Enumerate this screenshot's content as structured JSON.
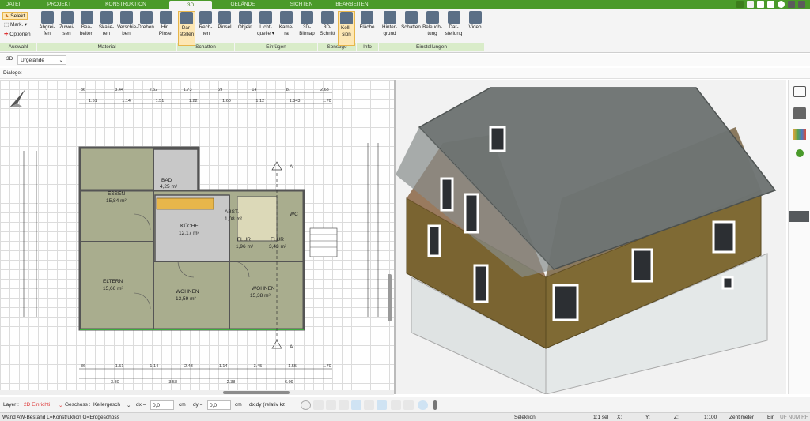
{
  "menu": {
    "tabs": [
      "DATEI",
      "PROJEKT",
      "KONSTRUKTION",
      "3D",
      "GELÄNDE",
      "SICHTEN",
      "BEARBEITEN"
    ],
    "active": "3D"
  },
  "ribbon": {
    "auswahl": {
      "selekt": "Selekt",
      "mark": "Mark.",
      "optionen": "Optionen",
      "group": "Auswahl"
    },
    "material": {
      "buttons": [
        "Abgrei-\nfen",
        "Zuwei-\nsen",
        "Bea-\nbeiten",
        "Skalie-\nren",
        "Verschie-\nben",
        "Drehen",
        "Hin.\nPinsel"
      ],
      "group": "Material"
    },
    "schatten": {
      "buttons": [
        "Dar-\nstellen",
        "Rech-\nnen",
        "Pinsel"
      ],
      "group": "Schatten"
    },
    "einfuegen": {
      "buttons": [
        "Objekt",
        "Licht-\nquelle ▾",
        "Kame-\nra",
        "3D-\nBitmap"
      ],
      "group": "Einfügen"
    },
    "sonstige": {
      "buttons": [
        "3D-\nSchnitt",
        "Kolli-\nsion"
      ],
      "group": "Sonstige"
    },
    "info": {
      "buttons": [
        "Fläche"
      ],
      "group": "Info"
    },
    "einstellungen": {
      "buttons": [
        "Hinter-\ngrund",
        "Schatten",
        "Beleuch-\ntung",
        "Dar-\nstellung",
        "Video"
      ],
      "group": "Einstellungen"
    }
  },
  "subbar": {
    "view_prefix": "3D",
    "terrain": "Urgelände"
  },
  "dialoge_label": "Dialoge:",
  "plan": {
    "rooms": [
      {
        "name": "ESSEN",
        "area": "15,84 m²"
      },
      {
        "name": "BAD",
        "area": "4,25 m²"
      },
      {
        "name": "KÜCHE",
        "area": "12,17 m²"
      },
      {
        "name": "ABST.",
        "area": "1,08 m²"
      },
      {
        "name": "WC",
        "area": ""
      },
      {
        "name": "FLUR",
        "area": "1,96 m²"
      },
      {
        "name": "FLUR",
        "area": "3,43 m²"
      },
      {
        "name": "ELTERN",
        "area": "15,66 m²"
      },
      {
        "name": "WOHNEN",
        "area": "13,59 m²"
      },
      {
        "name": "WOHNEN",
        "area": "15,38 m²"
      }
    ],
    "top_dims_1": [
      "36",
      "3.44",
      "2.52",
      "1.73",
      "69",
      "14",
      "87",
      "2.68"
    ],
    "top_dims_2": [
      "1.51",
      "1.14",
      "1.51",
      "1.22",
      "1.60",
      "1.12",
      "1.843",
      "1.70"
    ],
    "bottom_dims_1": [
      "36",
      "1.51",
      "1.14",
      "2.43",
      "1.14",
      "3.45",
      "1.55",
      "1.70"
    ],
    "bottom_dims_2": [
      "3.80",
      "3.58",
      "2.38",
      "6.09"
    ],
    "section_mark": "A"
  },
  "bottombar": {
    "layer_label": "Layer :",
    "layer_value": "2D Einrichti",
    "geschoss_label": "Geschoss :",
    "geschoss_value": "Kellergesch",
    "dx_label": "dx =",
    "dx_value": "0,0",
    "dx_unit": "cm",
    "dy_label": "dy =",
    "dy_value": "0,0",
    "dy_unit": "cm",
    "mode": "dx,dy (relativ kz"
  },
  "status": {
    "left": "Wand AW-Bestand L=Konstruktion G=Erdgeschoss",
    "mode": "Selektion",
    "sel": "1:1 sel",
    "x": "X:",
    "y": "Y:",
    "z": "Z:",
    "scale": "1:100",
    "unit": "Zentimeter",
    "ein": "Ein",
    "flags": "UF NUM RF"
  },
  "colors": {
    "accent": "#4a9a2a",
    "active": "#fde7b4",
    "wall": "#7a6230",
    "roof": "#6e7473"
  }
}
